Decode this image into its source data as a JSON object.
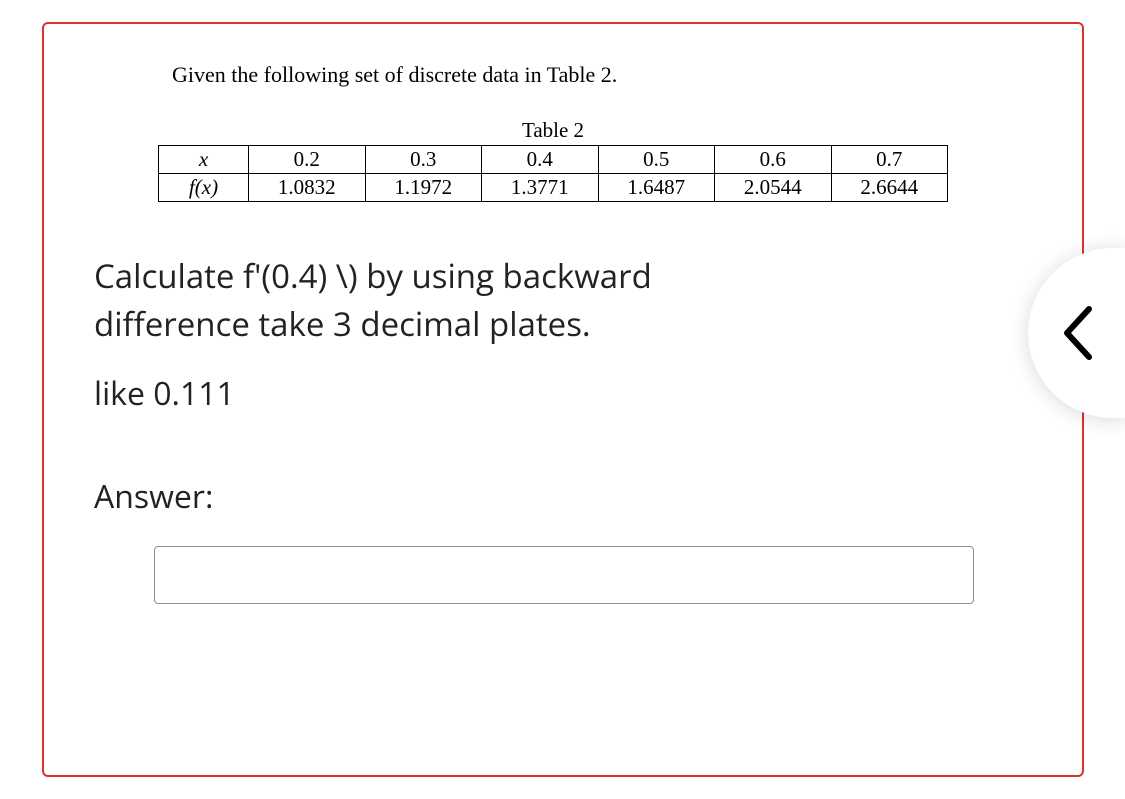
{
  "intro": "Given the following set of discrete data in Table 2.",
  "table": {
    "caption": "Table 2",
    "row_x_head": "x",
    "row_fx_head": "f(x)",
    "x": [
      "0.2",
      "0.3",
      "0.4",
      "0.5",
      "0.6",
      "0.7"
    ],
    "fx": [
      "1.0832",
      "1.1972",
      "1.3771",
      "1.6487",
      "2.0544",
      "2.6644"
    ]
  },
  "question_line1": "Calculate f'(0.4) \\) by using backward",
  "question_line2": "difference take 3 decimal plates.",
  "like_text": "like 0.111",
  "answer_label": "Answer:",
  "answer_value": "",
  "nav_icon": "chevron-left",
  "chart_data": {
    "type": "table",
    "title": "Table 2",
    "columns": [
      "x",
      "f(x)"
    ],
    "rows": [
      [
        0.2,
        1.0832
      ],
      [
        0.3,
        1.1972
      ],
      [
        0.4,
        1.3771
      ],
      [
        0.5,
        1.6487
      ],
      [
        0.6,
        2.0544
      ],
      [
        0.7,
        2.6644
      ]
    ]
  }
}
